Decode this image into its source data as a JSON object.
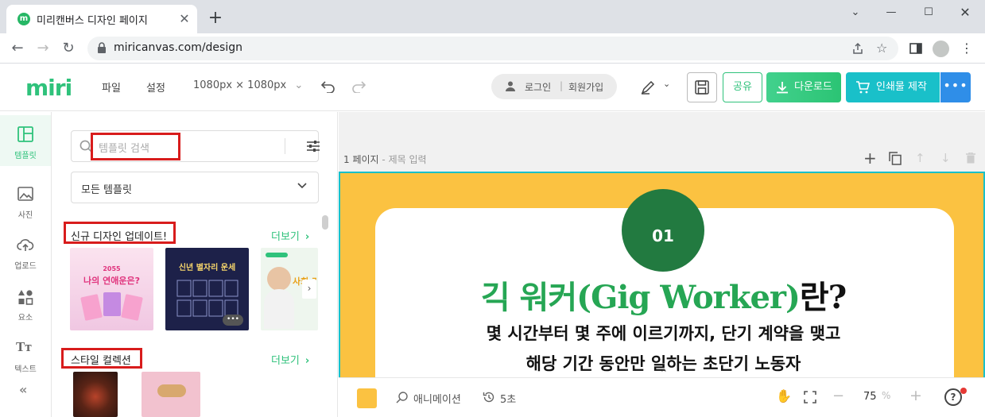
{
  "browser": {
    "tab_title": "미리캔버스 디자인 페이지",
    "favicon_letter": "m",
    "new_tab": "+",
    "url": "miricanvas.com/design"
  },
  "app": {
    "logo": "miri",
    "menu": {
      "file": "파일",
      "settings": "설정",
      "size": "1080px × 1080px"
    },
    "login": "로그인",
    "signup": "회원가입",
    "share": "공유",
    "download": "다운로드",
    "print": "인쇄물 제작",
    "more": "•••"
  },
  "rail": [
    {
      "label": "템플릿",
      "icon": "template-icon"
    },
    {
      "label": "사진",
      "icon": "photo-icon"
    },
    {
      "label": "업로드",
      "icon": "upload-icon"
    },
    {
      "label": "요소",
      "icon": "elements-icon"
    },
    {
      "label": "텍스트",
      "icon": "text-icon"
    }
  ],
  "panel": {
    "search_placeholder": "템플릿 검색",
    "category": "모든 템플릿",
    "sections": [
      {
        "title": "신규 디자인 업데이트!",
        "more": "더보기"
      },
      {
        "title": "스타일 컬렉션",
        "more": "더보기"
      }
    ],
    "thumbs": {
      "t1_year": "2055",
      "t1_title": "나의 연애운은?",
      "t2_title": "신년 별자리 운세",
      "t3_title": "사회 가이"
    }
  },
  "canvas": {
    "page_label": "1 페이지",
    "page_title_placeholder": "제목 입력",
    "badge": "01",
    "headline_green": "긱 워커(Gig Worker)",
    "headline_black": "란?",
    "line1": "몇 시간부터 몇 주에 이르기까지, 단기 계약을 맺고",
    "line2": "해당 기간 동안만 일하는 초단기 노동자",
    "bg_color": "#fbc241"
  },
  "bottom": {
    "animation": "애니메이션",
    "duration": "5초",
    "zoom": "75",
    "zoom_unit": "%"
  }
}
